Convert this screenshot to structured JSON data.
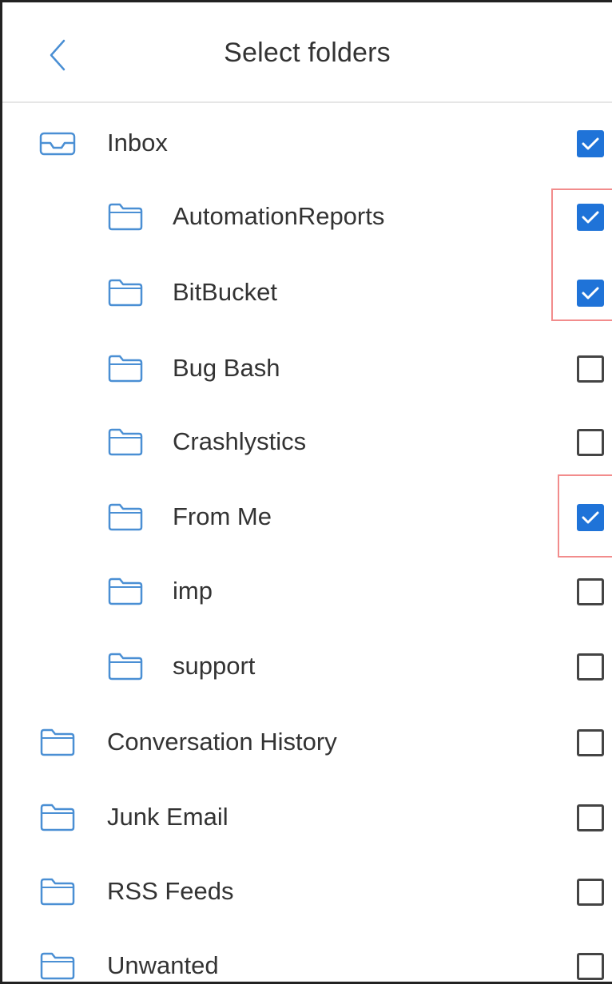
{
  "header": {
    "title": "Select folders",
    "back_icon": "chevron-left-icon"
  },
  "colors": {
    "accent": "#1f73d8",
    "folder_icon": "#4a8fd4",
    "highlight": "#f28c8c"
  },
  "folders": [
    {
      "name": "Inbox",
      "icon": "inbox-tray-icon",
      "level": 0,
      "checked": true
    },
    {
      "name": "AutomationReports",
      "icon": "folder-icon",
      "level": 1,
      "checked": true
    },
    {
      "name": "BitBucket",
      "icon": "folder-icon",
      "level": 1,
      "checked": true
    },
    {
      "name": "Bug Bash",
      "icon": "folder-icon",
      "level": 1,
      "checked": false
    },
    {
      "name": "Crashlystics",
      "icon": "folder-icon",
      "level": 1,
      "checked": false
    },
    {
      "name": "From Me",
      "icon": "folder-icon",
      "level": 1,
      "checked": true
    },
    {
      "name": "imp",
      "icon": "folder-icon",
      "level": 1,
      "checked": false
    },
    {
      "name": "support",
      "icon": "folder-icon",
      "level": 1,
      "checked": false
    },
    {
      "name": "Conversation History",
      "icon": "folder-icon",
      "level": 0,
      "checked": false
    },
    {
      "name": "Junk Email",
      "icon": "folder-icon",
      "level": 0,
      "checked": false
    },
    {
      "name": "RSS Feeds",
      "icon": "folder-icon",
      "level": 0,
      "checked": false
    },
    {
      "name": "Unwanted",
      "icon": "folder-icon",
      "level": 0,
      "checked": false
    }
  ]
}
